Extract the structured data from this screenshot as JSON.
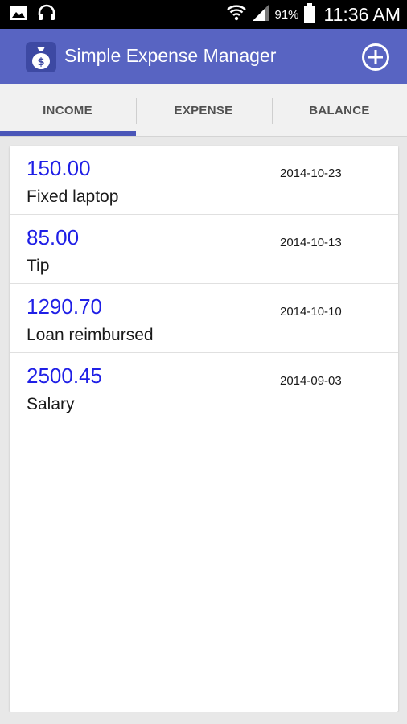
{
  "status_bar": {
    "battery_percent": "91%",
    "time": "11:36 AM",
    "icons": [
      "image-notification-icon",
      "headset-icon",
      "wifi-icon",
      "signal-icon",
      "battery-icon"
    ]
  },
  "app_bar": {
    "title": "Simple Expense Manager",
    "logo_icon": "money-bag-icon",
    "add_icon": "add-circle-icon",
    "color": "#5864c2"
  },
  "tabs": [
    {
      "label": "INCOME",
      "selected": true
    },
    {
      "label": "EXPENSE",
      "selected": false
    },
    {
      "label": "BALANCE",
      "selected": false
    }
  ],
  "colors": {
    "accent": "#4a56b8",
    "amount": "#1f1fe6"
  },
  "entries": [
    {
      "amount": "150.00",
      "description": "Fixed laptop",
      "date": "2014-10-23"
    },
    {
      "amount": "85.00",
      "description": "Tip",
      "date": "2014-10-13"
    },
    {
      "amount": "1290.70",
      "description": "Loan reimbursed",
      "date": "2014-10-10"
    },
    {
      "amount": "2500.45",
      "description": "Salary",
      "date": "2014-09-03"
    }
  ]
}
